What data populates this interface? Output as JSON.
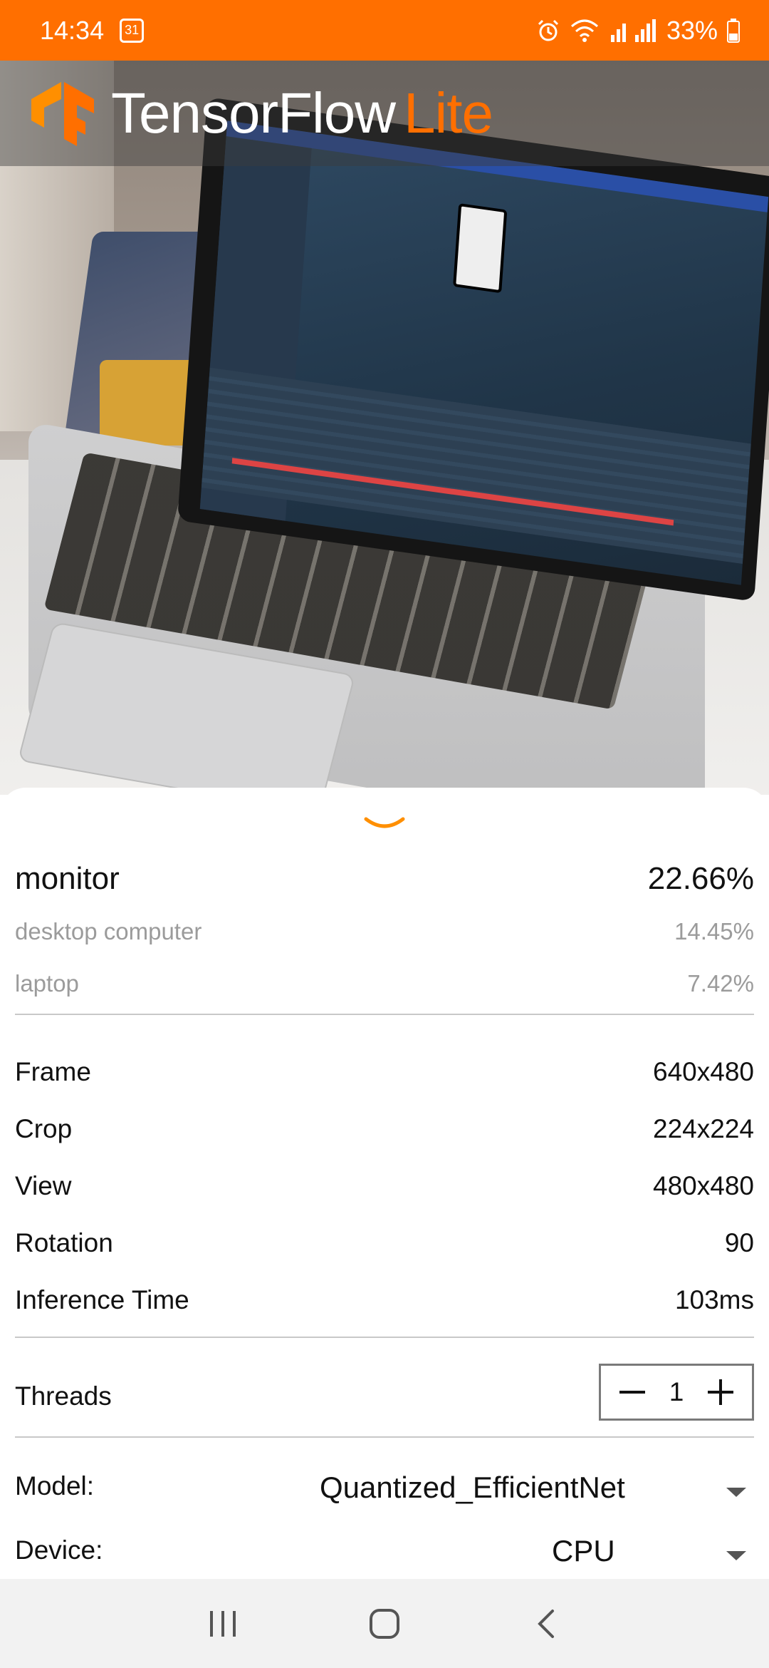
{
  "status_bar": {
    "time": "14:34",
    "calendar_day": "31",
    "battery": "33%",
    "icons": [
      "calendar-icon",
      "alarm-icon",
      "wifi-icon",
      "signal-icon",
      "battery-icon"
    ]
  },
  "app": {
    "brand_name": "TensorFlow",
    "brand_suffix": "Lite",
    "brand_color": "#FF6F00"
  },
  "predictions": [
    {
      "label": "monitor",
      "score": "22.66%"
    },
    {
      "label": "desktop computer",
      "score": "14.45%"
    },
    {
      "label": "laptop",
      "score": "7.42%"
    }
  ],
  "info": [
    {
      "label": "Frame",
      "value": "640x480"
    },
    {
      "label": "Crop",
      "value": "224x224"
    },
    {
      "label": "View",
      "value": "480x480"
    },
    {
      "label": "Rotation",
      "value": "90"
    },
    {
      "label": "Inference Time",
      "value": "103ms"
    }
  ],
  "threads": {
    "label": "Threads",
    "value": "1"
  },
  "model": {
    "label": "Model:",
    "value": "Quantized_EfficientNet"
  },
  "device": {
    "label": "Device:",
    "value": "CPU"
  },
  "nav": {
    "icons": [
      "recent-apps-icon",
      "home-icon",
      "back-icon"
    ]
  }
}
